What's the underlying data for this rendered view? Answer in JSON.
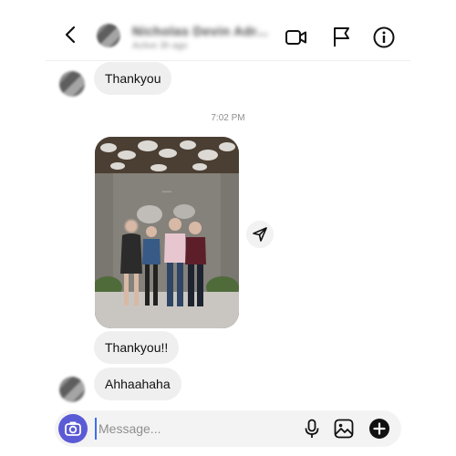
{
  "header": {
    "contact_name": "Nicholas Devin Adr...",
    "contact_status": "Active 3h ago"
  },
  "messages": {
    "m1": "Thankyou",
    "timestamp": "7:02 PM",
    "m2": "Thankyou!!",
    "m3": "Ahhaahaha"
  },
  "composer": {
    "placeholder": "Message..."
  },
  "colors": {
    "accent": "#5b5bd6",
    "bubble": "#efefef"
  },
  "icons": [
    "back-icon",
    "video-call-icon",
    "flag-icon",
    "info-icon",
    "share-icon",
    "camera-icon",
    "mic-icon",
    "gallery-icon",
    "plus-icon"
  ]
}
